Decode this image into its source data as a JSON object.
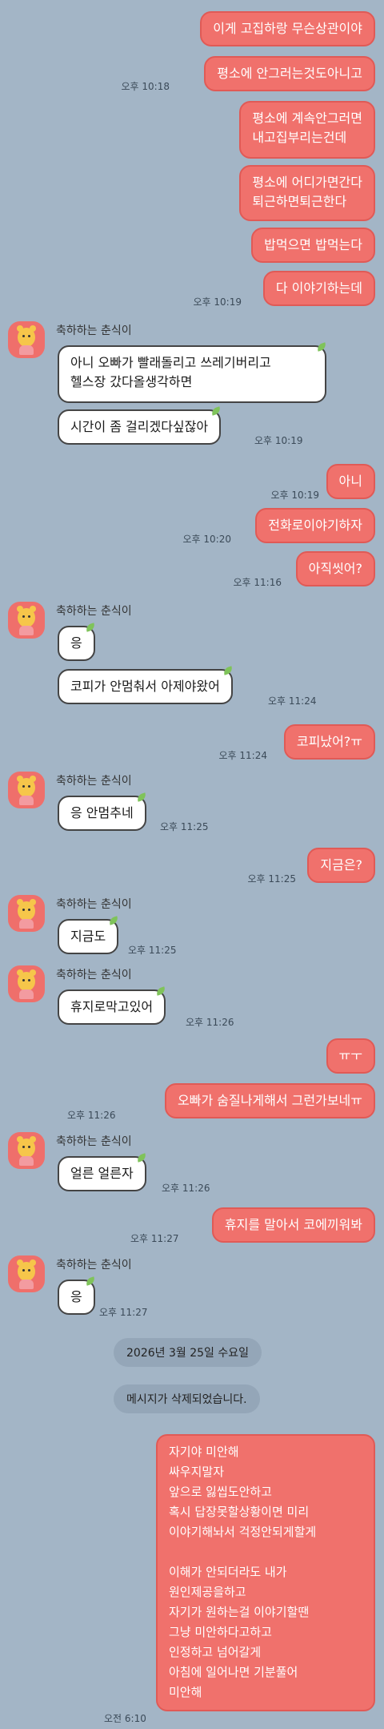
{
  "contact_name": "축하하는 춘식이",
  "colors": {
    "background": "#a3b5c6",
    "mine_bubble": "#f0716c",
    "theirs_bubble": "#ffffff"
  },
  "messages": [
    {
      "from": "me",
      "text": "이게 고집하랑 무슨상관이야"
    },
    {
      "from": "me",
      "text": "평소에 안그러는것도아니고",
      "time": "오후 10:18"
    },
    {
      "from": "me",
      "text": "평소에 계속안그러면\n내고집부리는건데"
    },
    {
      "from": "me",
      "text": "평소에 어디가면간다\n퇴근하면퇴근한다"
    },
    {
      "from": "me",
      "text": "밥먹으면 밥먹는다"
    },
    {
      "from": "me",
      "text": "다 이야기하는데",
      "time": "오후 10:19"
    },
    {
      "from": "them",
      "text": "아니 오빠가 빨래돌리고 쓰레기버리고\n헬스장 갔다올생각하면"
    },
    {
      "from": "them",
      "text": "시간이 좀 걸리겠다싶잖아",
      "time": "오후 10:19"
    },
    {
      "from": "me",
      "text": "아니",
      "time": "오후 10:19"
    },
    {
      "from": "me",
      "text": "전화로이야기하자",
      "time": "오후 10:20"
    },
    {
      "from": "me",
      "text": "아직씻어?",
      "time": "오후 11:16"
    },
    {
      "from": "them",
      "text": "응"
    },
    {
      "from": "them",
      "text": "코피가 안멈춰서 아제야왔어",
      "time": "오후 11:24"
    },
    {
      "from": "me",
      "text": "코피났어?ㅠ",
      "time": "오후 11:24"
    },
    {
      "from": "them",
      "text": "응 안멈추네",
      "time": "오후 11:25"
    },
    {
      "from": "me",
      "text": "지금은?",
      "time": "오후 11:25"
    },
    {
      "from": "them",
      "text": "지금도",
      "time": "오후 11:25"
    },
    {
      "from": "them",
      "text": "휴지로막고있어",
      "time": "오후 11:26"
    },
    {
      "from": "me",
      "text": "ㅠㅜ"
    },
    {
      "from": "me",
      "text": "오빠가 숨질나게해서  그런가보네ㅠ",
      "time": "오후 11:26"
    },
    {
      "from": "them",
      "text": "얼른 얼른자",
      "time": "오후 11:26"
    },
    {
      "from": "me",
      "text": "휴지를 말아서 코에끼워봐",
      "time": "오후 11:27"
    },
    {
      "from": "them",
      "text": "응",
      "time": "오후 11:27"
    },
    {
      "from": "me",
      "text": "자기야 미안해\n싸우지말자\n앞으로 잃씹도안하고\n혹시 답장못할상황이면 미리\n이야기해놔서 걱정안되게할게\n\n이해가 안되더라도 내가\n원인제공을하고\n자기가 원하는걸 이야기할땐\n그냥 미안하다고하고\n인정하고 넘어갈게\n아침에 일어나면 기분풀어\n미안해",
      "time": "오전 6:10"
    }
  ],
  "date_divider": "2026년 3월 25일 수요일",
  "deleted_notice": "메시지가 삭제되었습니다."
}
